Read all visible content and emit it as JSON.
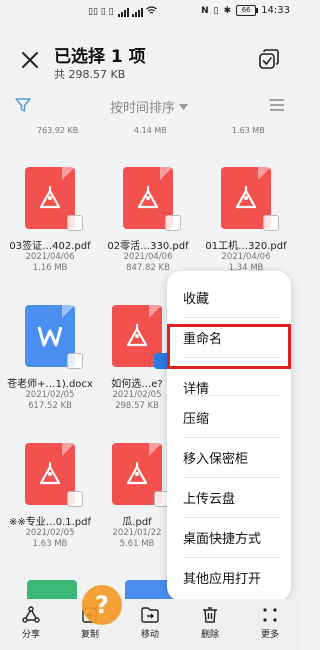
{
  "status": {
    "left": "▯▯ ▯ ▯",
    "time": "14:33",
    "battery": "66"
  },
  "header": {
    "title": "已选择 1 项",
    "subtitle": "共 298.57 KB"
  },
  "filter": {
    "sort_label": "按时间排序"
  },
  "partial_sizes": [
    "763.92 KB",
    "4.14 MB",
    "1.63 MB"
  ],
  "files": [
    {
      "name": "03签证…402.pdf",
      "date": "2021/04/06",
      "size": "1.16 MB",
      "type": "pdf",
      "color": "#f2514d"
    },
    {
      "name": "02零活…330.pdf",
      "date": "2021/04/06",
      "size": "847.82 KB",
      "type": "pdf",
      "color": "#f2514d"
    },
    {
      "name": "01工机…320.pdf",
      "date": "2021/04/06",
      "size": "1.34 MB",
      "type": "pdf",
      "color": "#f2514d"
    },
    {
      "name": "苍老师+…1).docx",
      "date": "2021/02/05",
      "size": "617.52 KB",
      "type": "word",
      "color": "#4a8ef0"
    },
    {
      "name": "如何选…e?",
      "date": "2021/02/05",
      "size": "298.57 KB",
      "type": "pdf",
      "color": "#f2514d"
    },
    {
      "name": "※※专业…0.1.pdf",
      "date": "2021/02/05",
      "size": "1.63 MB",
      "type": "pdf",
      "color": "#f2514d"
    },
    {
      "name": "瓜.pdf",
      "date": "2021/01/22",
      "size": "5.61 MB",
      "type": "pdf",
      "color": "#f2514d"
    }
  ],
  "menu": {
    "items": [
      "收藏",
      "重命名",
      "详情",
      "压缩",
      "移入保密柜",
      "上传云盘",
      "桌面快捷方式",
      "其他应用打开"
    ]
  },
  "bottom": {
    "items": [
      "分享",
      "复制",
      "移动",
      "删除",
      "更多"
    ]
  },
  "colors": {
    "pdf_red": "#f2514d",
    "word_blue": "#4a8ef0",
    "highlight": "#e02020",
    "green_file": "#3cb878"
  }
}
